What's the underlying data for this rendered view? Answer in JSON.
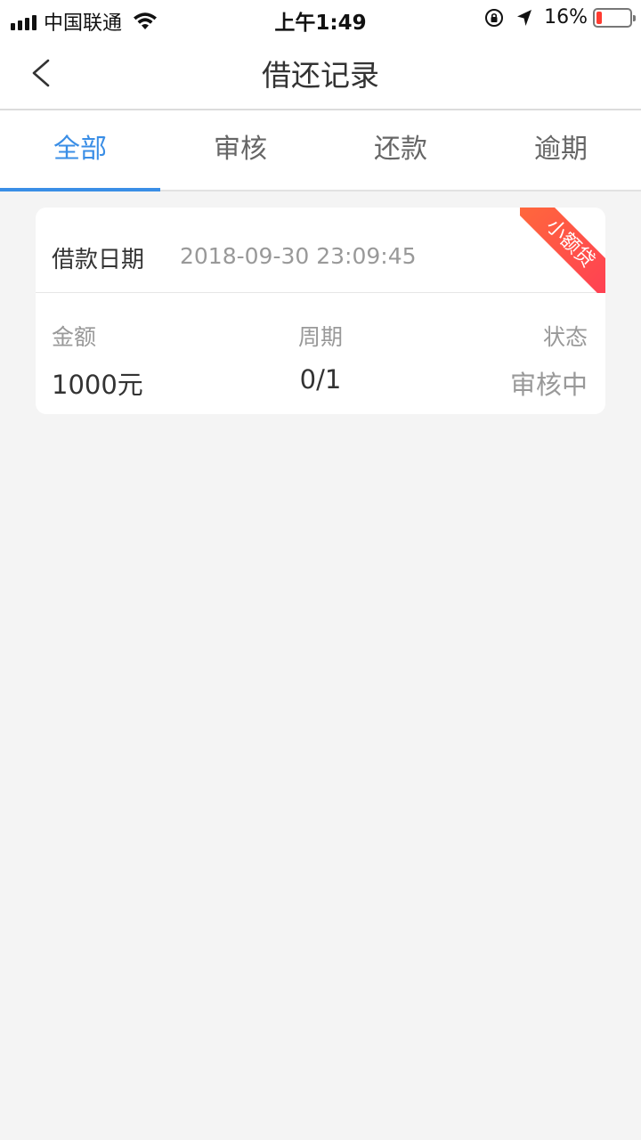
{
  "status_bar": {
    "carrier": "中国联通",
    "time": "上午1:49",
    "battery_percent": "16%",
    "battery_level": 0.16,
    "battery_color": "#ff3b30"
  },
  "nav": {
    "title": "借还记录",
    "back_icon": "chevron-left-icon"
  },
  "tabs": [
    {
      "label": "全部",
      "active": true
    },
    {
      "label": "审核",
      "active": false
    },
    {
      "label": "还款",
      "active": false
    },
    {
      "label": "逾期",
      "active": false
    }
  ],
  "accent_color": "#3a8ee6",
  "records": [
    {
      "date_label": "借款日期",
      "date_value": "2018-09-30 23:09:45",
      "tag": "小额贷",
      "amount_label": "金额",
      "amount_value": "1000元",
      "period_label": "周期",
      "period_value": "0/1",
      "status_label": "状态",
      "status_value": "审核中"
    }
  ]
}
